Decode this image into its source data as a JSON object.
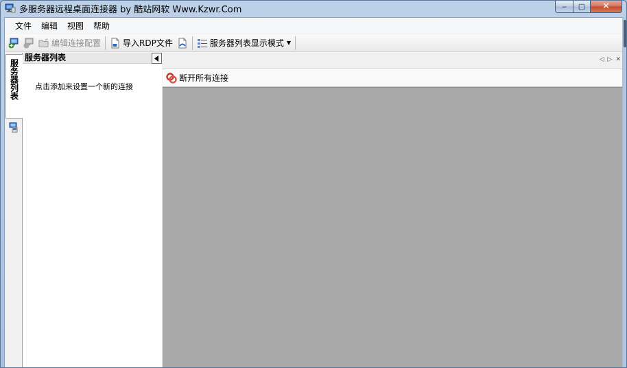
{
  "window": {
    "title": "多服务器远程桌面连接器 by 酷站网软 Www.Kzwr.Com",
    "controls": {
      "minimize": "‒",
      "maximize": "▢",
      "close": "✕"
    }
  },
  "menu": {
    "items": [
      {
        "id": "file",
        "label": "文件"
      },
      {
        "id": "edit",
        "label": "编辑"
      },
      {
        "id": "view",
        "label": "视图"
      },
      {
        "id": "help",
        "label": "帮助"
      }
    ]
  },
  "toolbar": {
    "edit_config_label": "编辑连接配置",
    "import_rdp_label": "导入RDP文件",
    "display_mode_label": "服务器列表显示模式"
  },
  "sidebar": {
    "tab_label": "服务器列表",
    "panel_title": "服务器列表",
    "hint": "点击添加来设置一个新的连接"
  },
  "document": {
    "disconnect_all_label": "断开所有连接"
  },
  "colors": {
    "canvas": "#a9a9a9",
    "titlebar": "#bcd0e8",
    "close_button": "#c24a30"
  }
}
